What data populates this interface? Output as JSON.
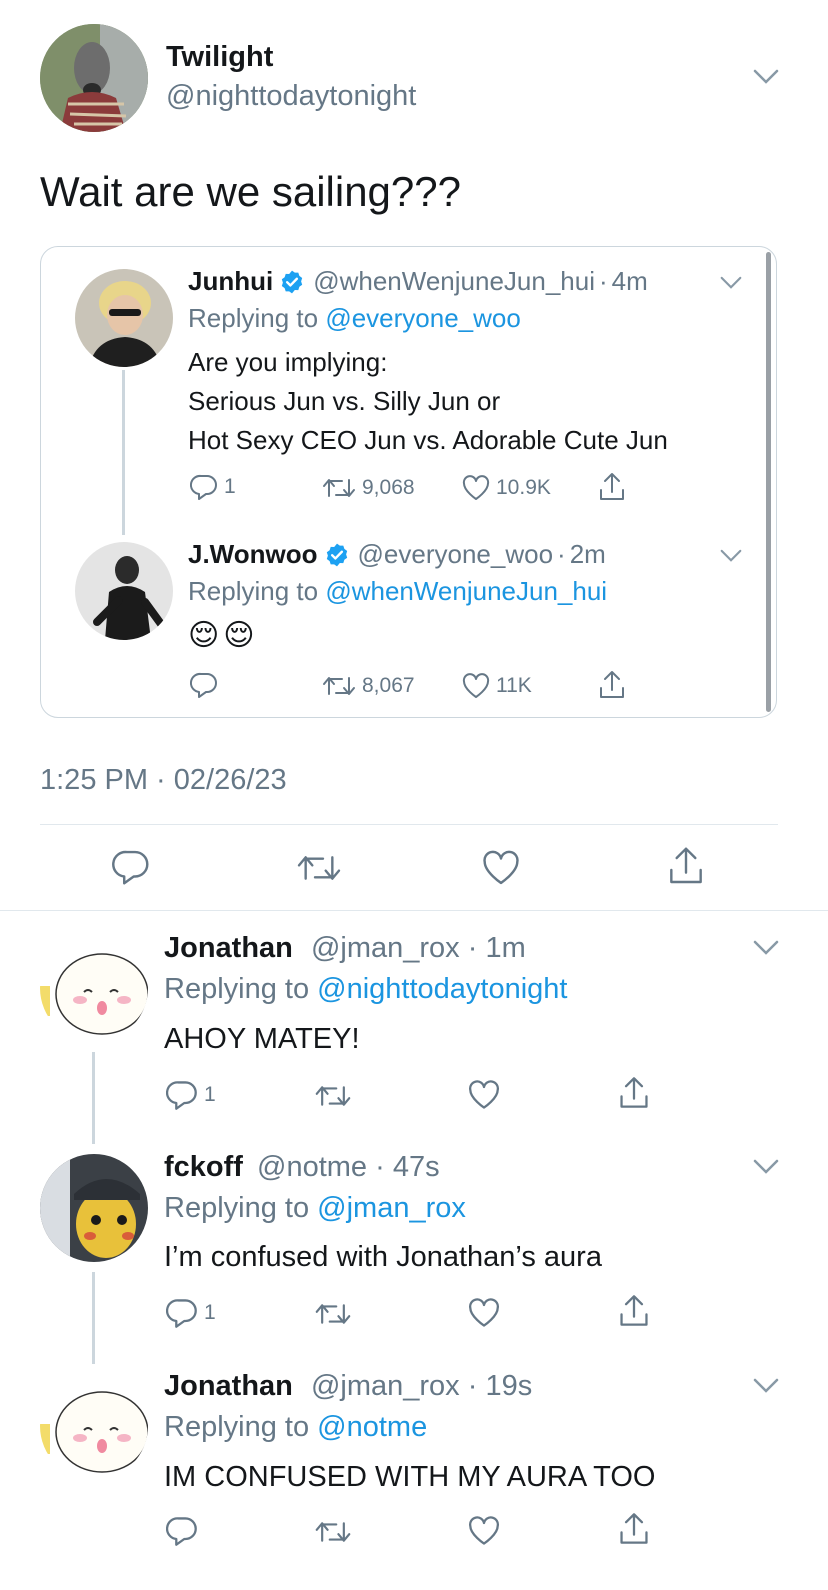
{
  "main_tweet": {
    "display_name": "Twilight",
    "handle": "@nighttodaytonight",
    "text": "Wait are we sailing???",
    "timestamp": "1:25 PM · 02/26/23"
  },
  "quoted_thread": [
    {
      "display_name": "Junhui",
      "verified": true,
      "handle": "@whenWenjuneJun_hui",
      "time": "4m",
      "replying_prefix": "Replying to",
      "replying_to": "@everyone_woo",
      "text_lines": [
        "Are you implying:",
        "Serious Jun vs. Silly Jun or",
        "Hot Sexy CEO Jun vs. Adorable Cute Jun"
      ],
      "replies": "1",
      "retweets": "9,068",
      "likes": "10.9K"
    },
    {
      "display_name": "J.Wonwoo",
      "verified": true,
      "handle": "@everyone_woo",
      "time": "2m",
      "replying_prefix": "Replying to",
      "replying_to": "@whenWenjuneJun_hui",
      "text_lines": [
        "😌😌"
      ],
      "replies": "",
      "retweets": "8,067",
      "likes": "11K"
    }
  ],
  "replies": [
    {
      "display_name": "Jonathan",
      "handle": "@jman_rox",
      "time": "1m",
      "replying_prefix": "Replying to",
      "replying_to": "@nighttodaytonight",
      "text": "AHOY MATEY!",
      "reply_count": "1"
    },
    {
      "display_name": "fckoff",
      "handle": "@notme",
      "time": "47s",
      "replying_prefix": "Replying to",
      "replying_to": "@jman_rox",
      "text": "I’m confused with Jonathan’s aura",
      "reply_count": "1"
    },
    {
      "display_name": "Jonathan",
      "handle": "@jman_rox",
      "time": "19s",
      "replying_prefix": "Replying to",
      "replying_to": "@notme",
      "text": "IM CONFUSED WITH MY AURA TOO",
      "reply_count": ""
    }
  ],
  "icons": {
    "reply": "reply-icon",
    "retweet": "retweet-icon",
    "like": "like-icon",
    "share": "share-icon",
    "more": "chevron-down-icon",
    "verified": "verified-badge-icon"
  },
  "colors": {
    "link": "#1b95e0",
    "secondary_text": "#657786",
    "verified": "#1da1f2",
    "divider": "#e1e8ed"
  }
}
